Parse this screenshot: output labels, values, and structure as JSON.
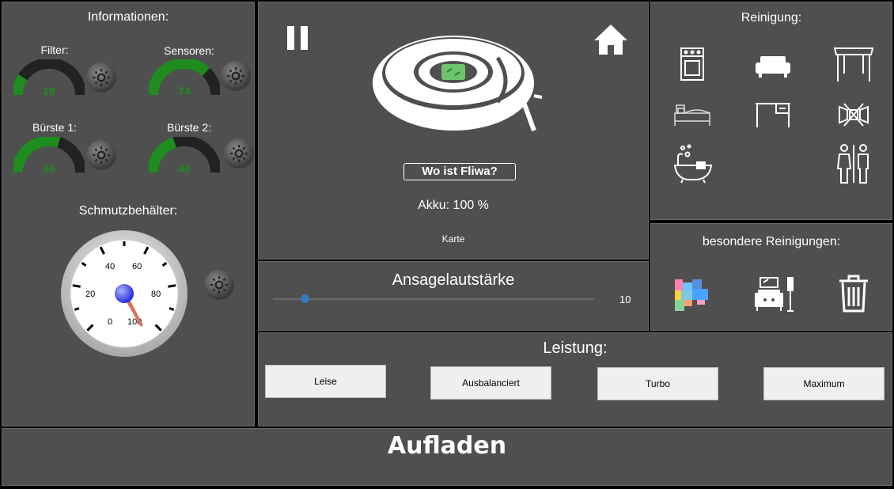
{
  "info": {
    "title": "Informationen:",
    "gauges": [
      {
        "label": "Filter:",
        "value": "19",
        "level": 0.19
      },
      {
        "label": "Sensoren:",
        "value": "74",
        "level": 0.74
      },
      {
        "label": "Bürste 1:",
        "value": "60",
        "level": 0.6
      },
      {
        "label": "Bürste 2:",
        "value": "40",
        "level": 0.4
      }
    ],
    "dirt_title": "Schmutzbehälter:",
    "dial_ticks": [
      "0",
      "20",
      "40",
      "60",
      "80",
      "100"
    ],
    "dial_value": 100
  },
  "robot": {
    "find_label": "Wo ist Fliwa?",
    "battery": "Akku: 100 %",
    "map_label": "Karte"
  },
  "volume": {
    "title": "Ansagelautstärke",
    "value": "10",
    "level": 0.1
  },
  "cleaning": {
    "title": "Reinigung:"
  },
  "special": {
    "title": "besondere Reinigungen:"
  },
  "power": {
    "title": "Leistung:",
    "modes": [
      "Leise",
      "Ausbalanciert",
      "Turbo",
      "Maximum"
    ]
  },
  "charge": {
    "label": "Aufladen"
  },
  "colors": {
    "panel": "#4f4f4f",
    "gauge_fill": "#1e8c1e",
    "gauge_track": "#222222",
    "gauge_text": "#1e8c1e"
  }
}
